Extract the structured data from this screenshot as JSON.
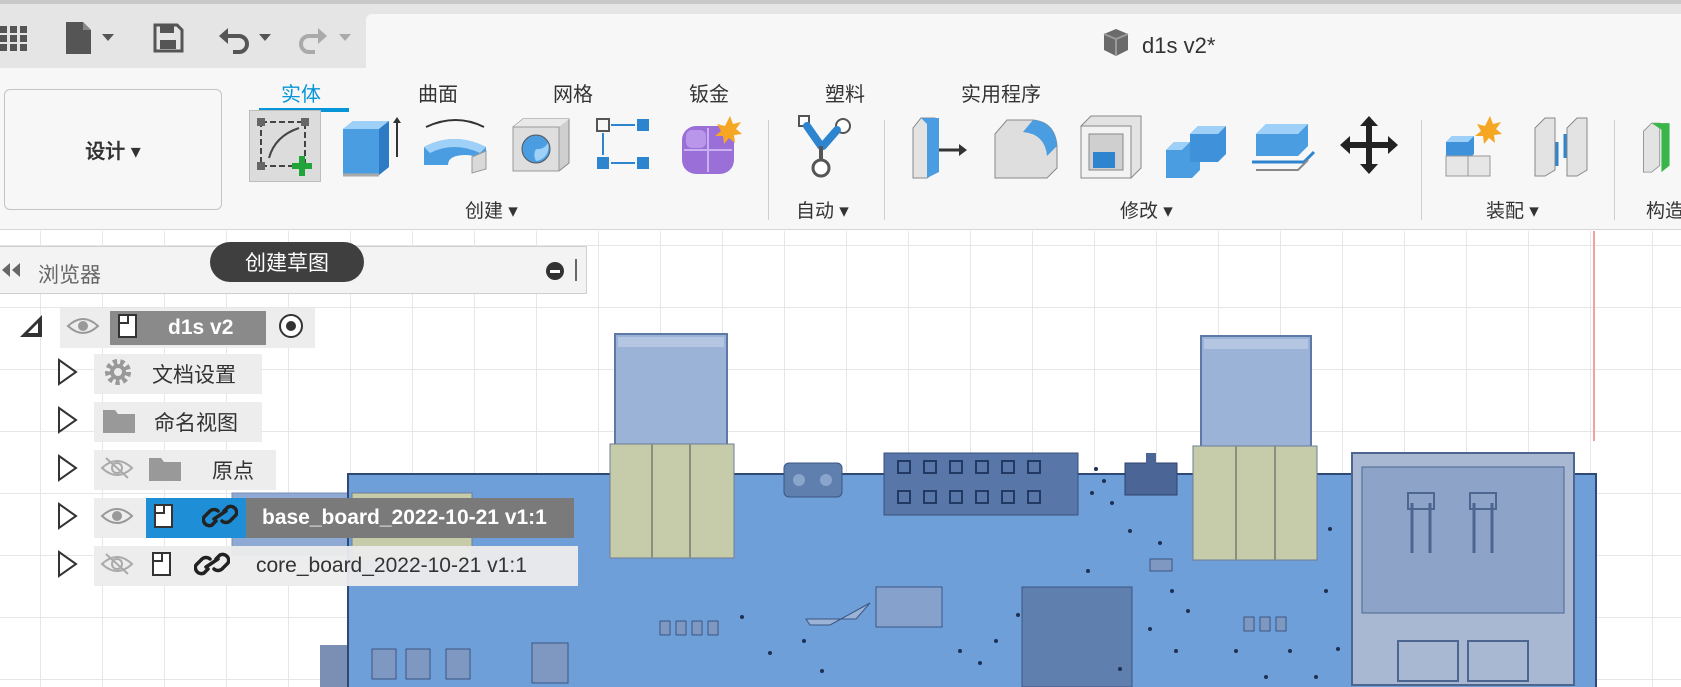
{
  "app": {
    "doc_title": "d1s v2*"
  },
  "toolbar": {
    "workspace_label": "设计 ▾",
    "tabs": [
      "实体",
      "曲面",
      "网格",
      "钣金",
      "塑料",
      "实用程序"
    ],
    "groups": {
      "create": "创建 ▾",
      "automate": "自动 ▾",
      "modify": "修改 ▾",
      "assemble": "装配 ▾",
      "construct": "构造"
    }
  },
  "tooltip": {
    "create_sketch": "创建草图"
  },
  "browser": {
    "title": "浏览器",
    "root": "d1s v2",
    "items": [
      "文档设置",
      "命名视图",
      "原点",
      "base_board_2022-10-21 v1:1",
      "core_board_2022-10-21 v1:1"
    ]
  },
  "colors": {
    "accent": "#0696d7",
    "selection": "#1e8fd6",
    "board": "#6f9fd8"
  }
}
